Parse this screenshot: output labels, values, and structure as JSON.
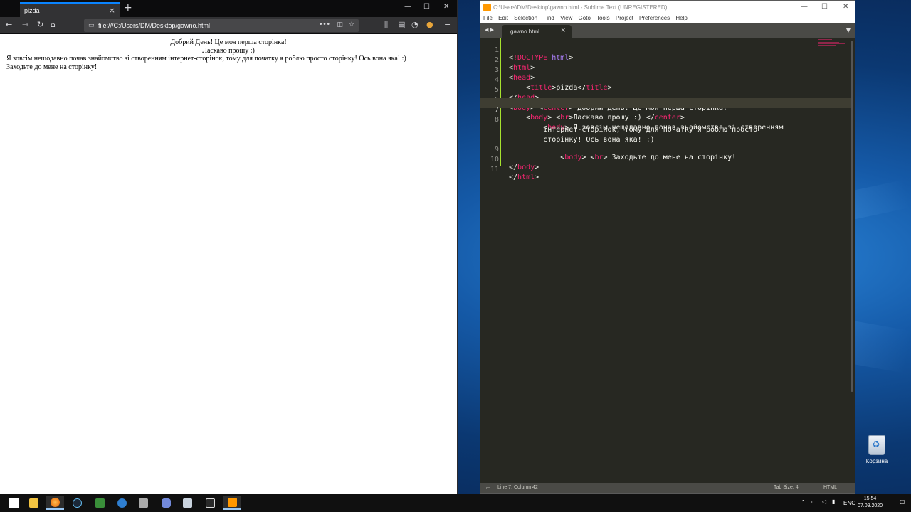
{
  "firefox": {
    "tab_title": "pizda",
    "url": "file:///C:/Users/DM/Desktop/gawno.html",
    "content": {
      "line1": "Добрий День! Це моя перша сторінка!",
      "line2": "Ласкаво прошу :)",
      "line3": "Я зовсім нещодавно почав знайомство зі створенням інтернет-сторінок, тому для початку я роблю просто сторінку! Ось вона яка! :)",
      "line4": "Заходьте до мене на сторінку!"
    }
  },
  "sublime": {
    "title": "C:\\Users\\DM\\Desktop\\gawno.html - Sublime Text (UNREGISTERED)",
    "menu": [
      "File",
      "Edit",
      "Selection",
      "Find",
      "View",
      "Goto",
      "Tools",
      "Project",
      "Preferences",
      "Help"
    ],
    "tab": "gawno.html",
    "status_left": "Line 7, Column 42",
    "tab_size": "Tab Size: 4",
    "syntax": "HTML",
    "line_numbers": [
      "1",
      "2",
      "3",
      "4",
      "5",
      "6",
      "7",
      "",
      "8",
      "",
      "",
      "9",
      "10",
      "11"
    ],
    "code": {
      "l1_a": "<!",
      "l1_b": "DOCTYPE",
      "l1_c": "html",
      "l1_d": ">",
      "l6_text": " Добрий День! Це моя перша сторінка!",
      "l7_text": "Ласкаво прошу :) ",
      "l8a_text": " Я зовсім нещодавно почав знайомство зі створенням",
      "l8b_text": "інтернет-сторінок, тому для початку я роблю просто",
      "l8c_text": "сторінку! Ось вона яка! :)",
      "l9_text": " Заходьте до мене на сторінку!",
      "title_text": "pizda"
    }
  },
  "desktop": {
    "recycle_bin": "Корзина"
  },
  "taskbar": {
    "lang": "ENG",
    "time": "15:54",
    "date": "07.09.2020"
  }
}
